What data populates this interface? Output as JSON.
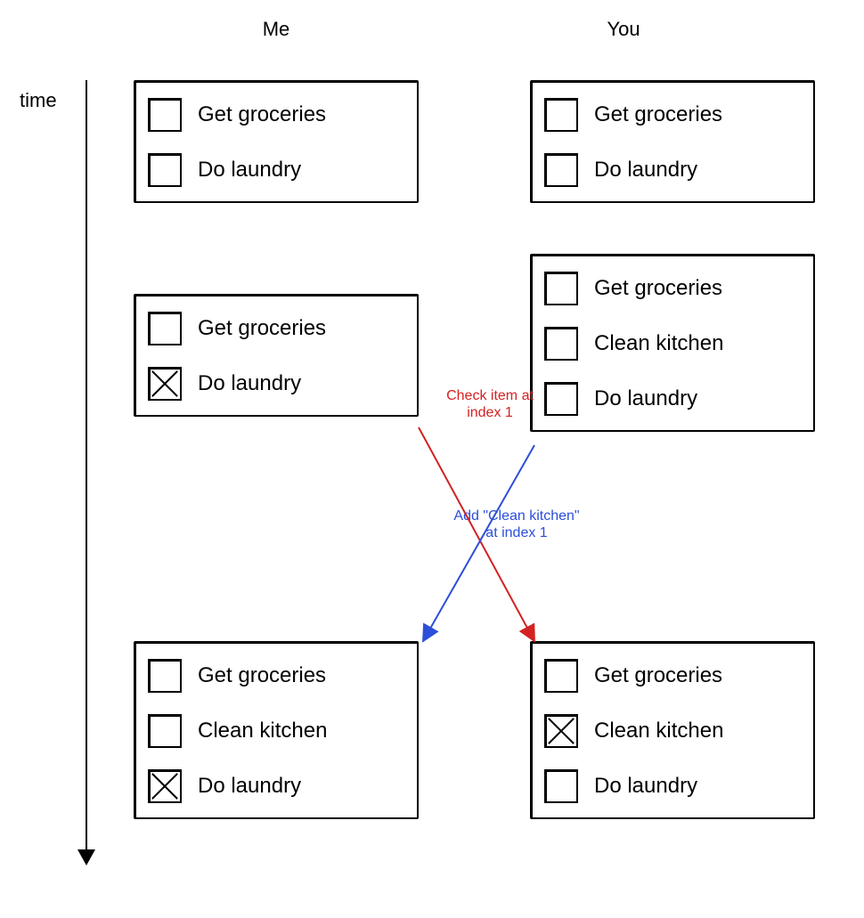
{
  "headers": {
    "me": "Me",
    "you": "You",
    "time": "time"
  },
  "columns": {
    "me": [
      {
        "items": [
          {
            "label": "Get groceries",
            "checked": false
          },
          {
            "label": "Do laundry",
            "checked": false
          }
        ]
      },
      {
        "items": [
          {
            "label": "Get groceries",
            "checked": false
          },
          {
            "label": "Do laundry",
            "checked": true
          }
        ]
      },
      {
        "items": [
          {
            "label": "Get groceries",
            "checked": false
          },
          {
            "label": "Clean kitchen",
            "checked": false
          },
          {
            "label": "Do laundry",
            "checked": true
          }
        ]
      }
    ],
    "you": [
      {
        "items": [
          {
            "label": "Get groceries",
            "checked": false
          },
          {
            "label": "Do laundry",
            "checked": false
          }
        ]
      },
      {
        "items": [
          {
            "label": "Get groceries",
            "checked": false
          },
          {
            "label": "Clean kitchen",
            "checked": false
          },
          {
            "label": "Do laundry",
            "checked": false
          }
        ]
      },
      {
        "items": [
          {
            "label": "Get groceries",
            "checked": false
          },
          {
            "label": "Clean kitchen",
            "checked": true
          },
          {
            "label": "Do laundry",
            "checked": false
          }
        ]
      }
    ]
  },
  "annotations": {
    "check": "Check item at\nindex 1",
    "add": "Add \"Clean kitchen\"\nat index 1"
  },
  "colors": {
    "check_arrow": "#d32222",
    "add_arrow": "#2b4fd8"
  }
}
